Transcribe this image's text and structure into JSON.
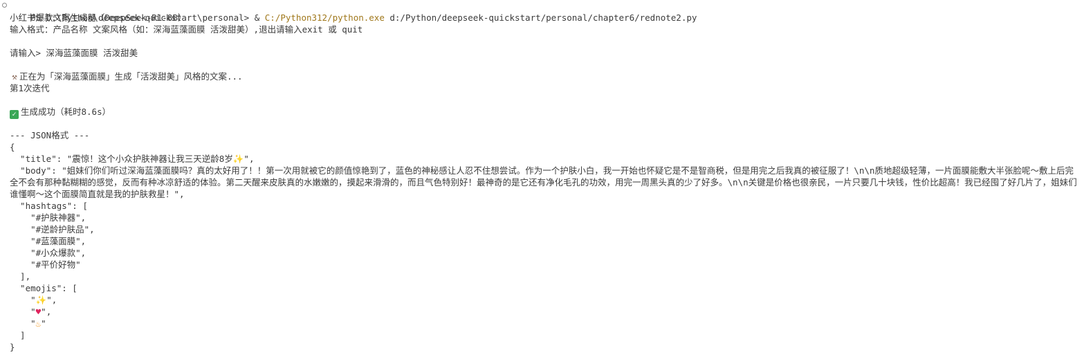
{
  "prompt": {
    "prefix": "PS D:\\Python\\deepseek-quickstart\\personal> & ",
    "exe": "C:/Python312/python.exe",
    "script": " d:/Python/deepseek-quickstart/personal/chapter6/rednote2.py"
  },
  "app_title": "小红书爆款文案生成器（DeepSeek-R1-8B）",
  "input_hint": "输入格式：产品名称 文案风格（如：深海蓝藻面膜 活泼甜美）,退出请输入exit 或 quit",
  "user_input": "请输入> 深海蓝藻面膜 活泼甜美",
  "generating": "正在为「深海蓝藻面膜」生成「活泼甜美」风格的文案...",
  "iteration": "第1次迭代",
  "success": "生成成功（耗时8.6s）",
  "json_header": "--- JSON格式 ---",
  "json": {
    "open_brace": "{",
    "title_line": "  \"title\": \"震惊！这个小众护肤神器让我三天逆龄8岁",
    "title_end": "\",",
    "body_line": "  \"body\": \"姐妹们你们听过深海蓝藻面膜吗？真的太好用了！！第一次用就被它的颜值惊艳到了，蓝色的神秘感让人忍不住想尝试。作为一个护肤小白，我一开始也怀疑它是不是智商税，但是用完之后我真的被征服了！\\n\\n质地超级轻薄，一片面膜能敷大半张脸呢～敷上后完全不会有那种黏糊糊的感觉，反而有种冰凉舒适的体验。第二天醒来皮肤真的水嫩嫩的，摸起来滑滑的，而且气色特别好！最神奇的是它还有净化毛孔的功效，用完一周黑头真的少了好多。\\n\\n关键是价格也很亲民，一片只要几十块钱，性价比超高！我已经囤了好几片了，姐妹们谁懂啊～这个面膜简直就是我的护肤救星！\",",
    "hashtags_open": "  \"hashtags\": [",
    "hashtags": [
      "    \"#护肤神器\",",
      "    \"#逆龄护肤品\",",
      "    \"#蓝藻面膜\",",
      "    \"#小众爆款\",",
      "    \"#平价好物\""
    ],
    "hashtags_close": "  ],",
    "emojis_open": "  \"emojis\": [",
    "emojis": {
      "e1_pre": "    \"",
      "e1_post": "\",",
      "e2_pre": "    \"",
      "e2_post": "\",",
      "e3_pre": "    \"",
      "e3_post": "\""
    },
    "emojis_close": "  ]",
    "close_brace": "}"
  },
  "icons": {
    "tool": "hammer-and-wrench-icon",
    "check": "check-mark-button-icon",
    "sparkles": "sparkles-icon",
    "heart": "heart-with-ribbon-icon",
    "fire": "fire-icon",
    "prompt_status": "circle-icon"
  },
  "colors": {
    "background": "#ffffff",
    "text": "#3b3b3b",
    "exe_path": "#a0781c",
    "check_green": "#3aa757"
  }
}
